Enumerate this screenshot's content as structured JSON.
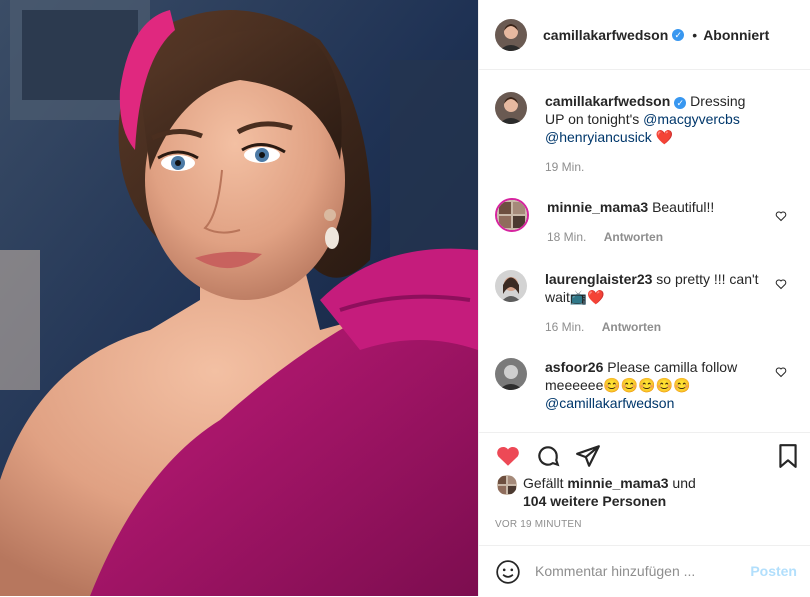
{
  "post": {
    "username": "camillakarfwedson",
    "verified_badge": "✓",
    "separator": "•",
    "follow_status": "Abonniert",
    "caption": {
      "username": "camillakarfwedson",
      "text": "Dressing UP on tonight's",
      "mention1": "@macgyvercbs",
      "mention2": "@henryiancusick",
      "emoji": "❤️",
      "time": "19 Min."
    },
    "comments": [
      {
        "username": "minnie_mama3",
        "text": "Beautiful!!",
        "time": "18 Min.",
        "reply": "Antworten"
      },
      {
        "username": "laurenglaister23",
        "text": "so pretty !!! can't wait📺❤️",
        "time": "16 Min.",
        "reply": "Antworten"
      },
      {
        "username": "asfoor26",
        "text": "Please camilla follow meeeeee😊😊😊😊😊",
        "mention": "@camillakarfwedson"
      }
    ],
    "likes": {
      "prefix": "Gefällt",
      "user": "minnie_mama3",
      "and": "und",
      "others": "104 weitere Personen"
    },
    "timestamp": "VOR 19 MINUTEN",
    "add_comment": {
      "placeholder": "Kommentar hinzufügen ...",
      "post_label": "Posten"
    },
    "icons": [
      "heart-filled-icon",
      "comment-icon",
      "share-icon",
      "bookmark-icon",
      "emoji-icon",
      "heart-outline-icon"
    ],
    "colors": {
      "like_red": "#ed4956",
      "link": "#00376b",
      "verified_blue": "#3897f0",
      "post_disabled": "#b2dffc",
      "dress_magenta": "#b5176f"
    }
  }
}
